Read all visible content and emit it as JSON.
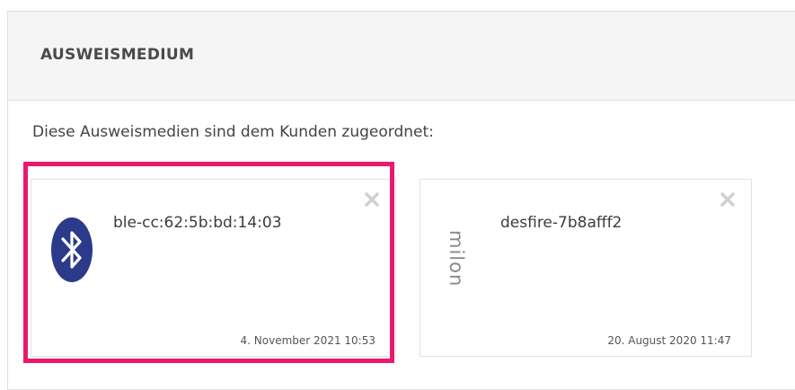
{
  "panel": {
    "title": "AUSWEISMEDIUM",
    "intro": "Diese Ausweismedien sind dem Kunden zugeordnet:"
  },
  "media": [
    {
      "id": "ble-cc:62:5b:bd:14:03",
      "date": "4. November 2021 10:53",
      "icon": "bluetooth-icon",
      "highlighted": true
    },
    {
      "id": "desfire-7b8afff2",
      "date": "20. August 2020 11:47",
      "icon": "milon-logo",
      "logo_text": "milon"
    }
  ],
  "colors": {
    "highlight": "#e8196f",
    "bluetooth": "#2b3a8a"
  }
}
